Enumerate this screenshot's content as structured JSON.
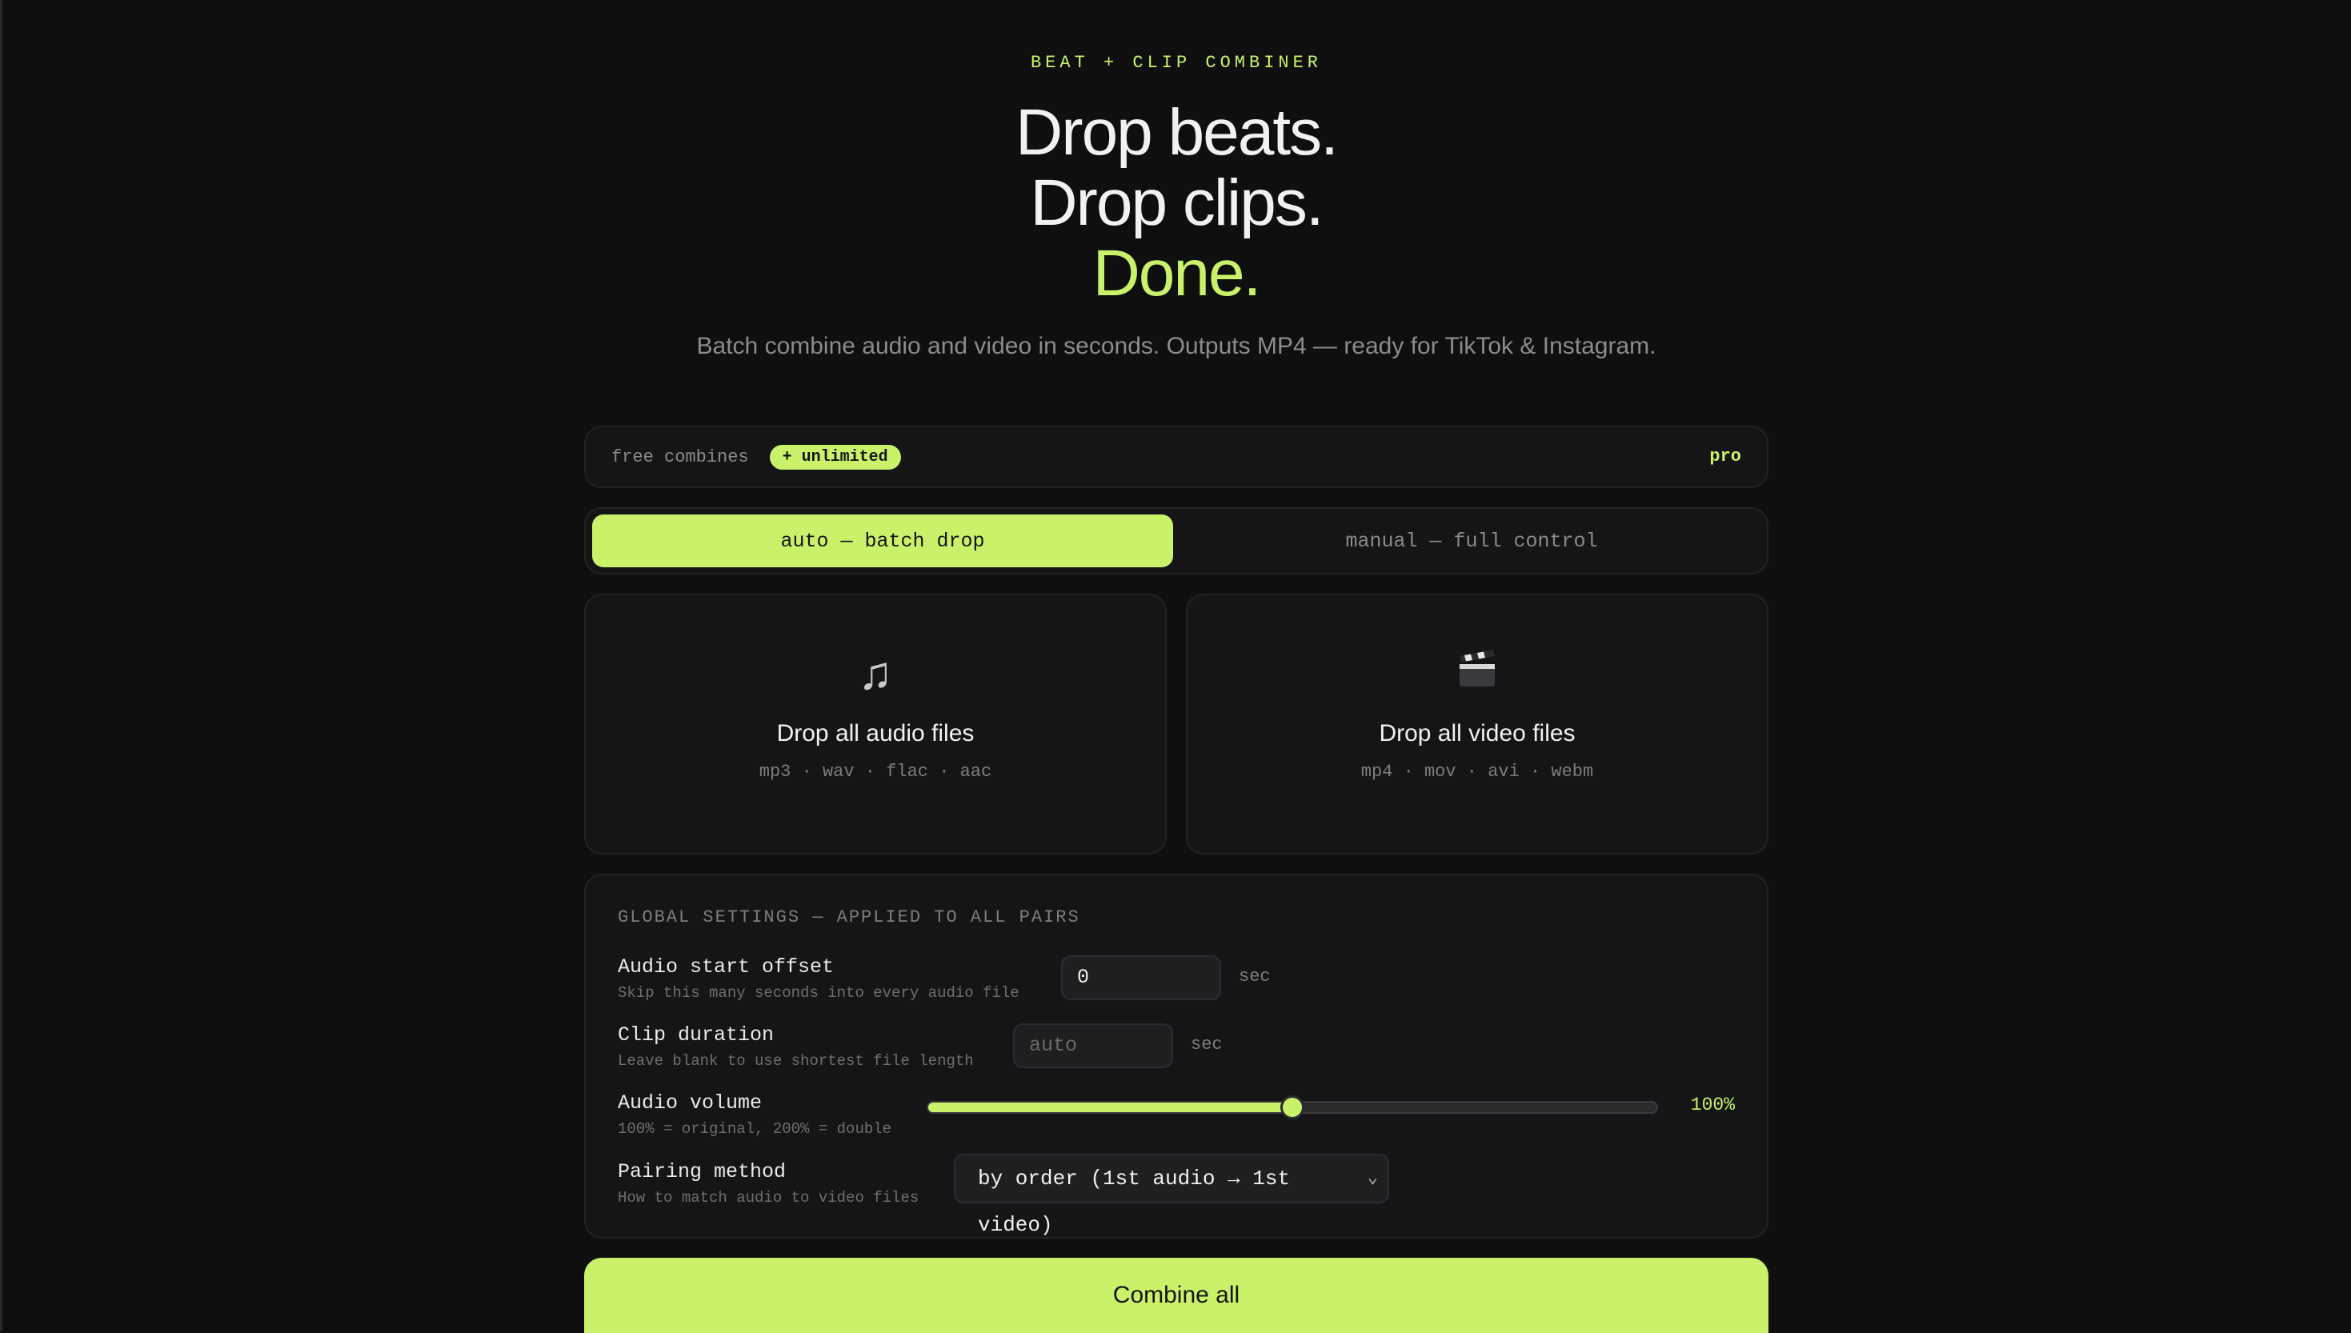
{
  "header": {
    "eyebrow": "BEAT + CLIP COMBINER",
    "line1": "Drop beats.",
    "line2": "Drop clips.",
    "line3": "Done.",
    "subtitle": "Batch combine audio and video in seconds. Outputs MP4 — ready for TikTok & Instagram."
  },
  "usage": {
    "free_label": "free combines",
    "badge": "+ unlimited",
    "pro_label": "pro"
  },
  "tabs": [
    {
      "label": "auto — batch drop",
      "active": true
    },
    {
      "label": "manual — full control",
      "active": false
    }
  ],
  "dropzones": {
    "audio": {
      "icon": "music-note-icon",
      "title": "Drop all audio files",
      "formats": "mp3 · wav · flac · aac"
    },
    "video": {
      "icon": "clapperboard-icon",
      "title": "Drop all video files",
      "formats": "mp4 · mov · avi · webm"
    }
  },
  "settings": {
    "heading": "GLOBAL SETTINGS — APPLIED TO ALL PAIRS",
    "offset": {
      "label": "Audio start offset",
      "hint": "Skip this many seconds into every audio file",
      "value": "0",
      "unit": "sec"
    },
    "duration": {
      "label": "Clip duration",
      "hint": "Leave blank to use shortest file length",
      "placeholder": "auto",
      "unit": "sec"
    },
    "volume": {
      "label": "Audio volume",
      "hint": "100% = original, 200% = double",
      "value_label": "100%",
      "fraction": 0.5
    },
    "pairing": {
      "label": "Pairing method",
      "hint": "How to match audio to video files",
      "selected": "by order (1st audio → 1st video)"
    }
  },
  "actions": {
    "combine_label": "Combine all"
  },
  "colors": {
    "accent": "#c9f26a",
    "background": "#0f0f10",
    "card": "#151517"
  }
}
